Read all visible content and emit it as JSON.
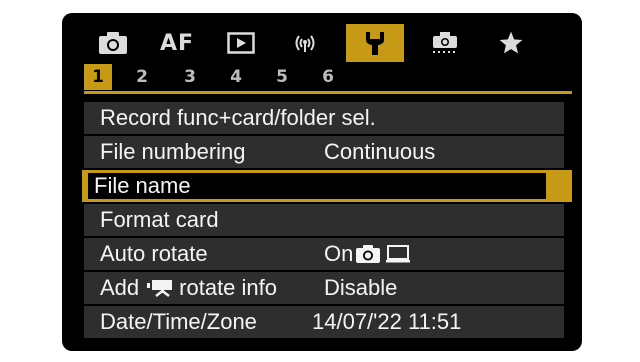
{
  "category_tabs": [
    {
      "name": "shooting",
      "icon": "camera-icon"
    },
    {
      "name": "af",
      "label": "AF"
    },
    {
      "name": "playback",
      "icon": "playback-icon"
    },
    {
      "name": "wireless",
      "icon": "wireless-icon"
    },
    {
      "name": "setup",
      "icon": "wrench-icon",
      "active": true
    },
    {
      "name": "custom",
      "icon": "custom-functions-icon"
    },
    {
      "name": "my-menu",
      "icon": "star-icon"
    }
  ],
  "page_tabs": [
    "1",
    "2",
    "3",
    "4",
    "5",
    "6"
  ],
  "active_page": "1",
  "menu": {
    "items": [
      {
        "label": "Record func+card/folder sel.",
        "value": ""
      },
      {
        "label": "File numbering",
        "value": "Continuous"
      },
      {
        "label": "File name",
        "value": "",
        "selected": true
      },
      {
        "label": "Format card",
        "value": ""
      },
      {
        "label": "Auto rotate",
        "value": "On"
      },
      {
        "label": "Add",
        "label_suffix": "rotate info",
        "value": "Disable"
      },
      {
        "label": "Date/Time/Zone",
        "value": "14/07/'22 11:51"
      }
    ]
  },
  "colors": {
    "accent": "#c69a14",
    "row_bg": "#2e2e2e",
    "screen_bg": "#000000",
    "text": "#f4f4f4"
  }
}
